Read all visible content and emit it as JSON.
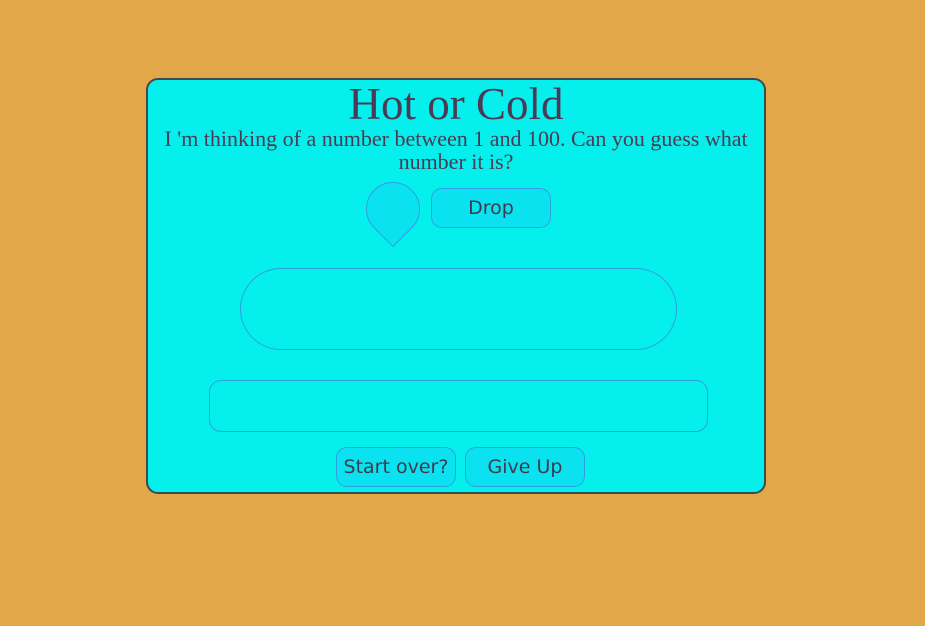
{
  "game": {
    "title": "Hot or Cold",
    "instructions": "I 'm thinking of a number between 1 and 100. Can you guess what number it is?",
    "drop_label": "Drop",
    "output_text": "",
    "guess_value": "",
    "restart_label": "Start over?",
    "give_up_label": "Give Up"
  },
  "colors": {
    "background": "#e2a748",
    "card": "#05f0ec",
    "button": "#0be2ef",
    "border": "#2f9fe0",
    "text": "#4a3a55"
  },
  "icons": {
    "drop": "water-drop-icon"
  }
}
